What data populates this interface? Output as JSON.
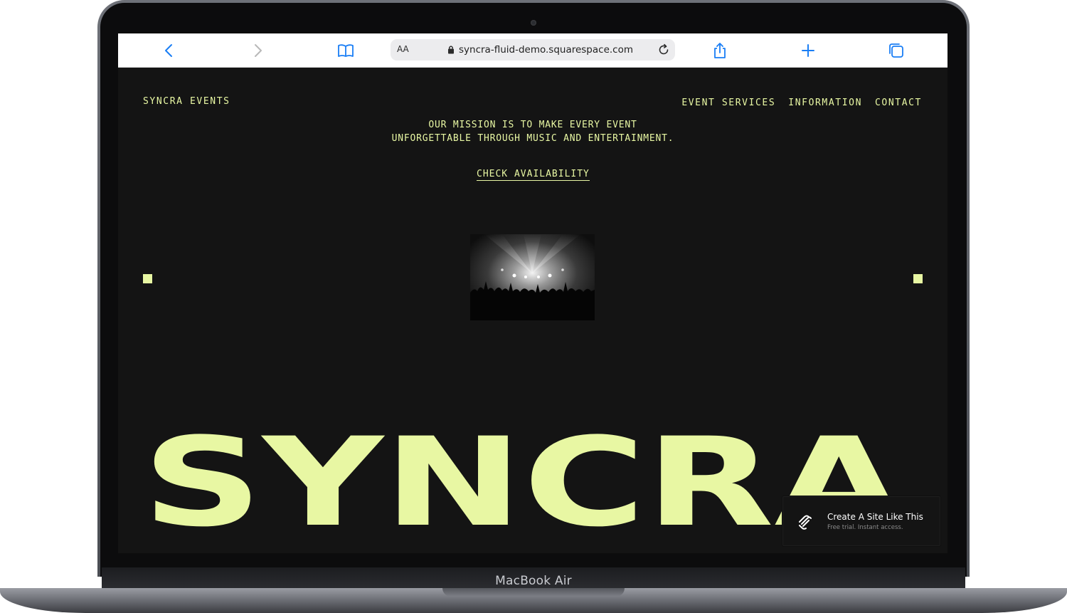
{
  "device": {
    "label": "MacBook Air"
  },
  "browser": {
    "text_size_label": "AA",
    "url": "syncra-fluid-demo.squarespace.com",
    "icons": {
      "back": "chevron-left-icon",
      "forward": "chevron-right-icon",
      "bookmarks": "book-icon",
      "lock": "lock-icon",
      "reload": "reload-icon",
      "share": "share-icon",
      "new_tab": "plus-icon",
      "tabs": "tabs-icon"
    },
    "accent_color": "#1a7ef5"
  },
  "site": {
    "brand": "SYNCRA EVENTS",
    "nav": [
      {
        "label": "EVENT SERVICES"
      },
      {
        "label": "INFORMATION"
      },
      {
        "label": "CONTACT"
      }
    ],
    "mission": "OUR MISSION IS TO MAKE EVERY EVENT UNFORGETTABLE THROUGH MUSIC AND ENTERTAINMENT.",
    "cta_label": "CHECK AVAILABILITY",
    "hero_image": "concert-crowd-photo",
    "wordmark": "SYNCRA",
    "colors": {
      "background": "#141414",
      "accent": "#e8f7a3"
    }
  },
  "badge": {
    "title": "Create A Site Like This",
    "subtitle": "Free trial. Instant access.",
    "logo": "squarespace-logo-icon"
  }
}
